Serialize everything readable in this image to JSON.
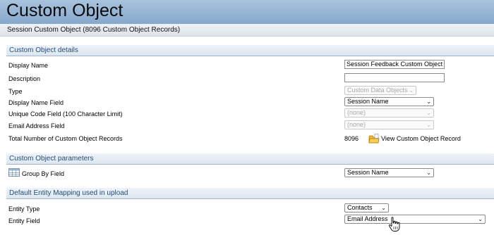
{
  "header": {
    "title": "Custom Object"
  },
  "subheader": {
    "text": "Session Custom Object (8096 Custom Object Records)"
  },
  "sections": {
    "details": "Custom Object details",
    "parameters": "Custom Object parameters",
    "mapping": "Default Entity Mapping used in upload"
  },
  "details": {
    "display_name_label": "Display Name",
    "display_name_value": "Session Feedback Custom Object",
    "description_label": "Description",
    "description_value": "",
    "type_label": "Type",
    "type_value": "Custom Data Objects",
    "display_name_field_label": "Display Name Field",
    "display_name_field_value": "Session Name",
    "unique_code_field_label": "Unique Code Field (100 Character Limit)",
    "unique_code_field_value": "(none)",
    "email_address_field_label": "Email Address Field",
    "email_address_field_value": "(none)",
    "total_records_label": "Total Number of Custom Object Records",
    "total_records_value": "8096",
    "view_record_link": "View Custom Object Record"
  },
  "parameters": {
    "group_by_label": "Group By Field",
    "group_by_value": "Session Name"
  },
  "mapping": {
    "entity_type_label": "Entity Type",
    "entity_type_value": "Contacts",
    "entity_field_label": "Entity Field",
    "entity_field_value": "Email Address"
  },
  "icons": {
    "view_record": "folder-icon",
    "group_by": "grid-icon",
    "cursor": "hand-pointer-icon",
    "dropdown": "chevron-down-icon"
  }
}
